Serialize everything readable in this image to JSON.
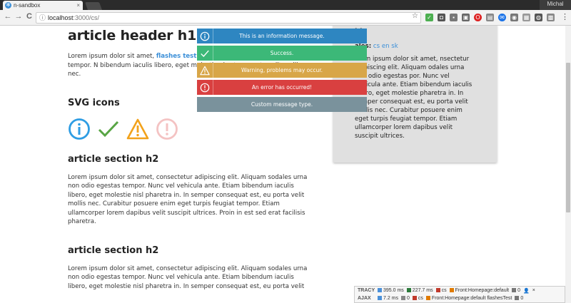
{
  "browser": {
    "tab_title": "n-sandbox",
    "tab_close": "×",
    "user": "Michal",
    "url_host": "localhost",
    "url_path": ":3000/cs/",
    "back": "←",
    "forward": "→",
    "reload": "C"
  },
  "main": {
    "h1": "article header h1",
    "intro_pre": "Lorem ipsum dolor sit amet, ",
    "intro_link": "flashes test",
    "intro_post": " sodales urna non odio egestas tempor. N bibendum iaculis libero, eget molestie ni est, eu porta velit mollis nec.",
    "svg_heading": "SVG icons",
    "sections": [
      {
        "title": "article section h2",
        "text": "Lorem ipsum dolor sit amet, consectetur adipiscing elit. Aliquam sodales urna non odio egestas tempor. Nunc vel vehicula ante. Etiam bibendum iaculis libero, eget molestie nisl pharetra in. In semper consequat est, eu porta velit mollis nec. Curabitur posuere enim eget turpis feugiat tempor. Etiam ullamcorper lorem dapibus velit suscipit ultrices. Proin in est sed erat facilisis pharetra."
      },
      {
        "title": "article section h2",
        "text": "Lorem ipsum dolor sit amet, consectetur adipiscing elit. Aliquam sodales urna non odio egestas tempor. Nunc vel vehicula ante. Etiam bibendum iaculis libero, eget molestie nisl pharetra in. In semper consequat est, eu porta velit"
      }
    ]
  },
  "aside": {
    "heading": "ide",
    "locales_label": "ales:",
    "locale_cs": "cs",
    "locale_en": "en",
    "locale_sk": "sk",
    "text": "orem ipsum dolor sit amet, nsectetur adipiscing elit. Aliquam odales urna non odio egestas por. Nunc vel vehicula ante. Etiam bibendum iaculis libero, eget molestie pharetra in. In semper consequat est, eu porta velit mollis nec. Curabitur posuere enim eget turpis feugiat tempor. Etiam ullamcorper lorem dapibus velit suscipit ultrices."
  },
  "flashes": [
    {
      "type": "info",
      "message": "This is an information message.",
      "color": "#2e86c1",
      "icon": "info-icon"
    },
    {
      "type": "success",
      "message": "Success.",
      "color": "#3cb878",
      "icon": "check-icon"
    },
    {
      "type": "warning",
      "message": "Warning, problems may occur.",
      "color": "#d8a648",
      "icon": "warning-icon"
    },
    {
      "type": "error",
      "message": "An error has occurred!",
      "color": "#d94040",
      "icon": "error-icon"
    },
    {
      "type": "custom",
      "message": "Custom message type.",
      "color": "#7a929c",
      "icon": ""
    }
  ],
  "tracy": {
    "row1": {
      "label": "TRACY",
      "time": "395.0 ms",
      "memory": "227.7 ms",
      "lang": "cs",
      "presenter": "Front:Homepage:default",
      "count": "0"
    },
    "row2": {
      "label": "AJAX",
      "time": "7.2 ms",
      "memory": "0",
      "lang": "cs",
      "presenter": "Front:Homepage:default flashesTest",
      "count": "0"
    }
  },
  "colors": {
    "accent": "#3b8fd8",
    "info": "#2e86c1",
    "success": "#3cb878",
    "warning": "#d8a648",
    "error": "#d94040",
    "custom": "#7a929c"
  }
}
